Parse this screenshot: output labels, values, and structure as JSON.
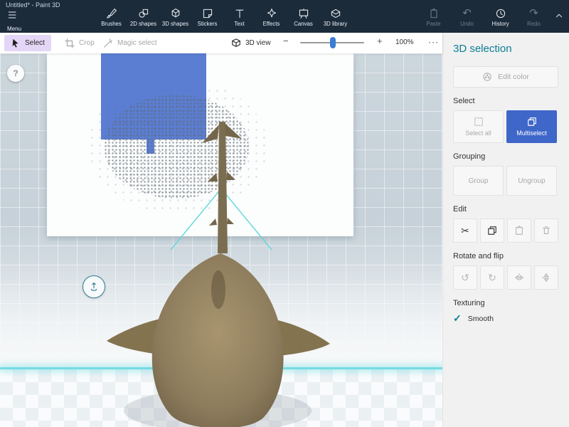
{
  "titlebar": {
    "title": "Untitled* - Paint 3D"
  },
  "toolbar": {
    "menu": "Menu",
    "items": [
      {
        "label": "Brushes"
      },
      {
        "label": "2D shapes"
      },
      {
        "label": "3D shapes"
      },
      {
        "label": "Stickers"
      },
      {
        "label": "Text"
      },
      {
        "label": "Effects"
      },
      {
        "label": "Canvas"
      },
      {
        "label": "3D library"
      }
    ],
    "right": [
      {
        "label": "Paste"
      },
      {
        "label": "Undo"
      },
      {
        "label": "History"
      },
      {
        "label": "Redo"
      }
    ]
  },
  "selectbar": {
    "select": "Select",
    "crop": "Crop",
    "magic_select": "Magic select",
    "view": "3D view",
    "zoom": "100%"
  },
  "panel": {
    "title": "3D selection",
    "edit_color": "Edit color",
    "select_heading": "Select",
    "select_all": "Select all",
    "multiselect": "Multiselect",
    "grouping_heading": "Grouping",
    "group": "Group",
    "ungroup": "Ungroup",
    "edit_heading": "Edit",
    "rotate_heading": "Rotate and flip",
    "texturing_heading": "Texturing",
    "smooth": "Smooth"
  },
  "glyphs": {
    "minus": "−",
    "plus": "+",
    "more": "···",
    "help": "?",
    "undo": "↶",
    "redo": "↷",
    "cut": "✂",
    "rotate_left": "↺",
    "rotate_right": "↻",
    "check": "✓"
  },
  "colors": {
    "topbar": "#1c2b3a",
    "accent_blue": "#3f66c9",
    "panel_title_teal": "#0c7d93",
    "selection_teal": "#5fd6dc",
    "paint_blue": "#5b7ed3"
  }
}
